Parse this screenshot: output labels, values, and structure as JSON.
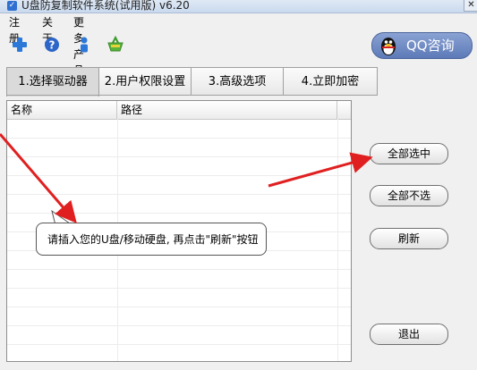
{
  "window": {
    "title": "U盘防复制软件系统(试用版) v6.20",
    "close_glyph": "✕"
  },
  "menu": [
    "注册",
    "关于",
    "更多产品"
  ],
  "toolbar": {
    "icons": [
      "add-icon",
      "help-icon",
      "user-icon",
      "basket-icon"
    ],
    "qq_button_label": "QQ咨询"
  },
  "tabs": [
    {
      "label": "1.选择驱动器",
      "active": true
    },
    {
      "label": "2.用户权限设置",
      "active": false
    },
    {
      "label": "3.高级选项",
      "active": false
    },
    {
      "label": "4.立即加密",
      "active": false
    }
  ],
  "drive_table": {
    "columns": [
      "名称",
      "路径"
    ],
    "rows": []
  },
  "side_buttons": {
    "select_all": "全部选中",
    "select_none": "全部不选",
    "refresh": "刷新",
    "exit": "退出"
  },
  "tooltip": {
    "text": "请插入您的U盘/移动硬盘, 再点击\"刷新\"按钮"
  },
  "colors": {
    "arrow": "#e02020",
    "qq_button": "#6e88c4",
    "active_tab": "#dadada",
    "titlebar": "#d3e0f1"
  }
}
